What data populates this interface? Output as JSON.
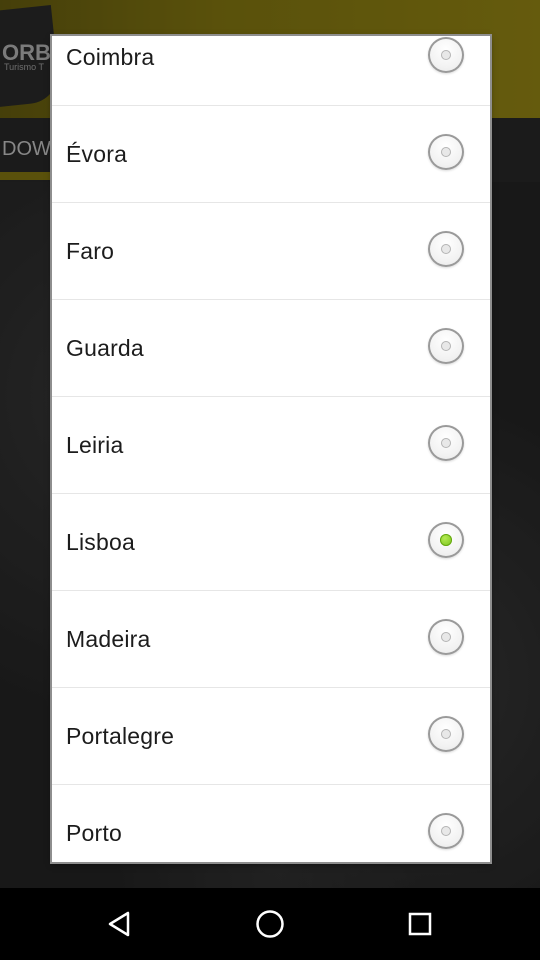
{
  "background_app": {
    "logo_text": "ORB",
    "logo_subtext": "Turismo T",
    "tab_partial": "DOW"
  },
  "dialog": {
    "options": [
      {
        "label": "Coimbra",
        "selected": false
      },
      {
        "label": "Évora",
        "selected": false
      },
      {
        "label": "Faro",
        "selected": false
      },
      {
        "label": "Guarda",
        "selected": false
      },
      {
        "label": "Leiria",
        "selected": false
      },
      {
        "label": "Lisboa",
        "selected": true
      },
      {
        "label": "Madeira",
        "selected": false
      },
      {
        "label": "Portalegre",
        "selected": false
      },
      {
        "label": "Porto",
        "selected": false
      }
    ]
  },
  "navbar": {
    "back_icon": "back-triangle-icon",
    "home_icon": "home-circle-icon",
    "recents_icon": "recents-square-icon"
  },
  "colors": {
    "selected_radio": "#76c11a",
    "header_accent": "#8a7d12"
  }
}
